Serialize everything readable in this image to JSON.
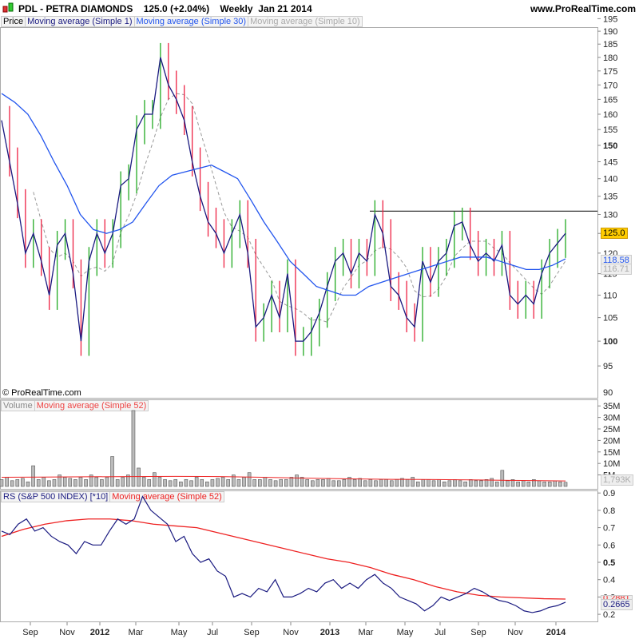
{
  "header": {
    "title": "PDL - PETRA DIAMONDS",
    "quote": "125.0 (+2.04%)",
    "period": "Weekly",
    "date": "Jan 21 2014",
    "site": "www.ProRealTime.com"
  },
  "price_panel": {
    "legend": [
      "Price",
      "Moving average (Simple 1)",
      "Moving average (Simple 30)",
      "Moving average (Simple 10)"
    ],
    "copyright": "© ProRealTime.com",
    "last_price_label": "125.0",
    "ma30_label": "118.58",
    "ma10_label": "116.71"
  },
  "volume_panel": {
    "legend": [
      "Volume",
      "Moving average (Simple 52)"
    ],
    "last_label": "1,793K"
  },
  "rs_panel": {
    "legend": [
      "RS (S&P 500 INDEX) [*10]",
      "Moving average (Simple 52)"
    ],
    "last_label": "0.2665",
    "ma_label": "0.2881"
  },
  "colors": {
    "up": "#22aa22",
    "down": "#ee2244",
    "line": "#1a1a80",
    "ma30": "#2255ee",
    "ma10": "#999999",
    "vol": "#888888",
    "ma_red": "#ee2222",
    "last_bg": "#ffcc00"
  },
  "chart_data": [
    {
      "type": "candlestick",
      "title": "PDL - PETRA DIAMONDS",
      "scale": "log",
      "ylim": [
        90,
        195
      ],
      "yticks": [
        95,
        100,
        105,
        110,
        115,
        120,
        125,
        130,
        135,
        140,
        145,
        150,
        155,
        160,
        165,
        170,
        175,
        180,
        185,
        190,
        195
      ],
      "xticks": [
        "Sep",
        "Nov",
        "2012",
        "Mar",
        "May",
        "Jul",
        "Sep",
        "Nov",
        "2013",
        "Mar",
        "May",
        "Jul",
        "Sep",
        "Nov",
        "2014"
      ],
      "closes": [
        158,
        145,
        133,
        120,
        125,
        118,
        110,
        122,
        125,
        115,
        100,
        118,
        125,
        120,
        125,
        138,
        140,
        155,
        160,
        160,
        180,
        170,
        165,
        158,
        145,
        135,
        128,
        125,
        120,
        125,
        130,
        120,
        103,
        105,
        110,
        105,
        115,
        100,
        100,
        102,
        106,
        112,
        118,
        120,
        115,
        120,
        118,
        130,
        125,
        112,
        110,
        105,
        103,
        118,
        113,
        118,
        120,
        127,
        128,
        122,
        118,
        120,
        118,
        122,
        110,
        108,
        110,
        108,
        115,
        120,
        122.5,
        125
      ],
      "ma30": [
        167,
        164,
        160,
        153,
        145,
        138,
        130,
        126,
        125,
        126,
        128,
        133,
        138,
        141,
        142,
        143,
        144,
        142,
        140,
        134,
        128,
        123,
        118,
        115,
        112,
        111,
        110,
        110,
        112,
        113,
        114,
        115,
        116,
        117,
        118,
        119,
        119,
        119,
        118,
        117,
        116,
        116,
        117,
        118.58
      ],
      "resistance": 130.9
    },
    {
      "type": "bar",
      "title": "Volume",
      "ylim": [
        0,
        37
      ],
      "yticks_M": [
        5,
        10,
        15,
        20,
        25,
        30,
        35
      ],
      "values": [
        3,
        4,
        2.5,
        3,
        3.5,
        2,
        9,
        3,
        4,
        2.5,
        3,
        5,
        4,
        3.5,
        3,
        4,
        3,
        5,
        4,
        3,
        4,
        13,
        3,
        4,
        5,
        33,
        8,
        4,
        3,
        6,
        4,
        3,
        2.5,
        3,
        2,
        3,
        2.5,
        4,
        3,
        2,
        3,
        3.5,
        4,
        3,
        5,
        3,
        4,
        6,
        3,
        3,
        4,
        3,
        2.5,
        3,
        3,
        4,
        5,
        4,
        3,
        2.5,
        3,
        3,
        3.5,
        2.5,
        2.5,
        3,
        4,
        3,
        3.5,
        2.5,
        3,
        2.5,
        3,
        3,
        2.5,
        3,
        3.5,
        3,
        4,
        2,
        3,
        3,
        2.5,
        3,
        2,
        2.5,
        3,
        2.5,
        2,
        3,
        2.5,
        2.5,
        3,
        3.5,
        2,
        7,
        2.5,
        3,
        2,
        2.5,
        2,
        3,
        2.5,
        2,
        2,
        2.5,
        2,
        1.8
      ],
      "ma52": [
        4,
        4.1,
        4.2,
        4.3,
        4.4,
        4.3,
        4,
        3.6,
        3.3,
        3.1,
        3,
        2.8,
        2.6,
        2.4
      ]
    },
    {
      "type": "line",
      "title": "RS (S&P 500 INDEX) [*10]",
      "ylim": [
        0.15,
        0.92
      ],
      "yticks": [
        0.2,
        0.3,
        0.4,
        0.5,
        0.6,
        0.7,
        0.8,
        0.9
      ],
      "rs": [
        0.68,
        0.66,
        0.72,
        0.75,
        0.68,
        0.7,
        0.65,
        0.62,
        0.6,
        0.55,
        0.62,
        0.6,
        0.6,
        0.68,
        0.75,
        0.72,
        0.75,
        0.88,
        0.8,
        0.76,
        0.72,
        0.62,
        0.65,
        0.55,
        0.5,
        0.52,
        0.45,
        0.42,
        0.3,
        0.32,
        0.3,
        0.35,
        0.33,
        0.4,
        0.3,
        0.3,
        0.32,
        0.35,
        0.33,
        0.38,
        0.4,
        0.35,
        0.38,
        0.35,
        0.4,
        0.43,
        0.38,
        0.35,
        0.3,
        0.28,
        0.26,
        0.22,
        0.25,
        0.3,
        0.28,
        0.3,
        0.32,
        0.35,
        0.33,
        0.3,
        0.28,
        0.27,
        0.25,
        0.22,
        0.21,
        0.22,
        0.24,
        0.25,
        0.27
      ],
      "ma52": [
        0.65,
        0.69,
        0.72,
        0.74,
        0.75,
        0.75,
        0.74,
        0.72,
        0.71,
        0.7,
        0.67,
        0.64,
        0.61,
        0.58,
        0.55,
        0.52,
        0.5,
        0.47,
        0.43,
        0.4,
        0.36,
        0.33,
        0.31,
        0.3,
        0.295,
        0.29,
        0.288
      ]
    }
  ]
}
